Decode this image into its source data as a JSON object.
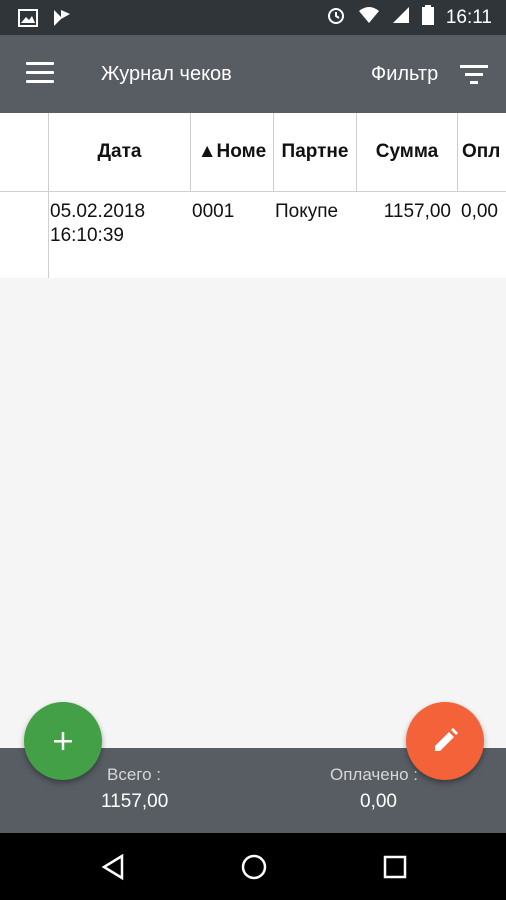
{
  "status_bar": {
    "time": "16:11",
    "icons": [
      "image-icon",
      "app-notification-icon",
      "alarm-icon",
      "wifi-icon",
      "signal-icon",
      "battery-icon"
    ]
  },
  "app_bar": {
    "title": "Журнал чеков",
    "filter_label": "Фильтр",
    "icons": [
      "menu-icon",
      "filter-icon"
    ]
  },
  "table": {
    "headers": [
      "Дата",
      "▲Номе",
      "Партне",
      "Сумма",
      "Опл"
    ],
    "rows": [
      {
        "date": "05.02.2018",
        "time": "16:10:39",
        "number": "0001",
        "partner": "Покупе",
        "sum": "1157,00",
        "paid": "0,00"
      }
    ]
  },
  "footer": {
    "total_label": "Всего :",
    "total_value": "1157,00",
    "paid_label": "Оплачено :",
    "paid_value": "0,00"
  },
  "fab": {
    "add_icon": "plus-icon",
    "edit_icon": "pencil-icon",
    "add_color": "#43a047",
    "edit_color": "#f4623a"
  },
  "colors": {
    "status_bar": "#30353a",
    "app_bar": "#575d63",
    "footer": "#575d63"
  }
}
